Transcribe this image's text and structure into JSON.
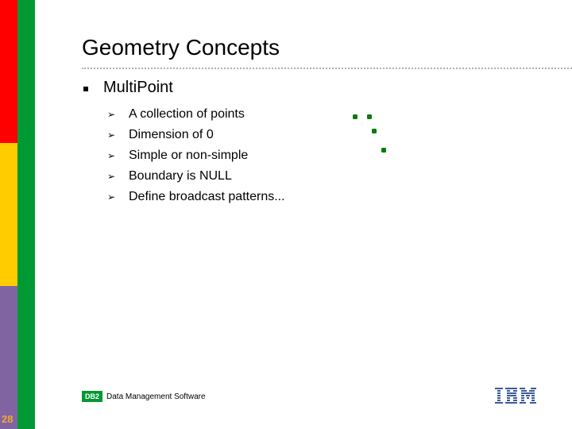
{
  "slide": {
    "title": "Geometry Concepts",
    "page_number": "28",
    "bullet": "MultiPoint",
    "sub_bullets": [
      "A collection of points",
      "Dimension of 0",
      "Simple or non-simple",
      "Boundary is NULL",
      "Define broadcast patterns..."
    ],
    "bullet_icon": "square-bullet",
    "sub_bullet_icon": "arrowhead-bullet"
  },
  "illustration": {
    "name": "multipoint-example",
    "point_color": "#0a7a0a",
    "point_count": 4
  },
  "footer": {
    "badge": "DB2",
    "product": "Data Management Software",
    "logo": "IBM"
  },
  "colors": {
    "strip_red": "#ff0000",
    "strip_yellow": "#ffcc00",
    "strip_purple": "#8064a2",
    "strip_green": "#009933",
    "page_number": "#f4a534"
  }
}
